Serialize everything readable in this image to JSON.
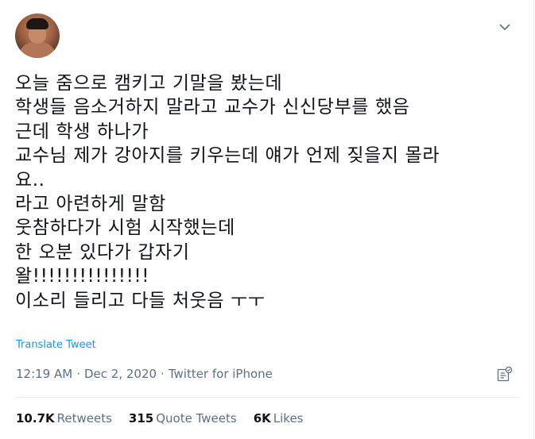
{
  "tweet": {
    "lines": [
      "오늘 줌으로 캠키고 기말을 봤는데",
      "학생들 음소거하지 말라고 교수가 신신당부를 했음",
      "근데 학생 하나가",
      "교수님 제가 강아지를 키우는데 얘가 언제 짖을지 몰라",
      "요..",
      "라고 아련하게 말함",
      "웃참하다가 시험 시작했는데",
      "한 오분 있다가 갑자기",
      "왈!!!!!!!!!!!!!!!",
      "이소리 들리고 다들 처웃음 ㅜㅜ"
    ],
    "translate_label": "Translate Tweet",
    "time": "12:19 AM",
    "date": "Dec 2, 2020",
    "source": "Twitter for iPhone",
    "separator": "·"
  },
  "stats": {
    "retweets_count": "10.7K",
    "retweets_label": "Retweets",
    "quotes_count": "315",
    "quotes_label": "Quote Tweets",
    "likes_count": "6K",
    "likes_label": "Likes"
  },
  "icons": {
    "menu": "chevron-down-icon",
    "analytics": "analytics-icon"
  },
  "colors": {
    "link": "#1b95e0",
    "secondary_text": "#5b7083",
    "divider": "#e6ecf0",
    "caret": "#5b7083"
  }
}
